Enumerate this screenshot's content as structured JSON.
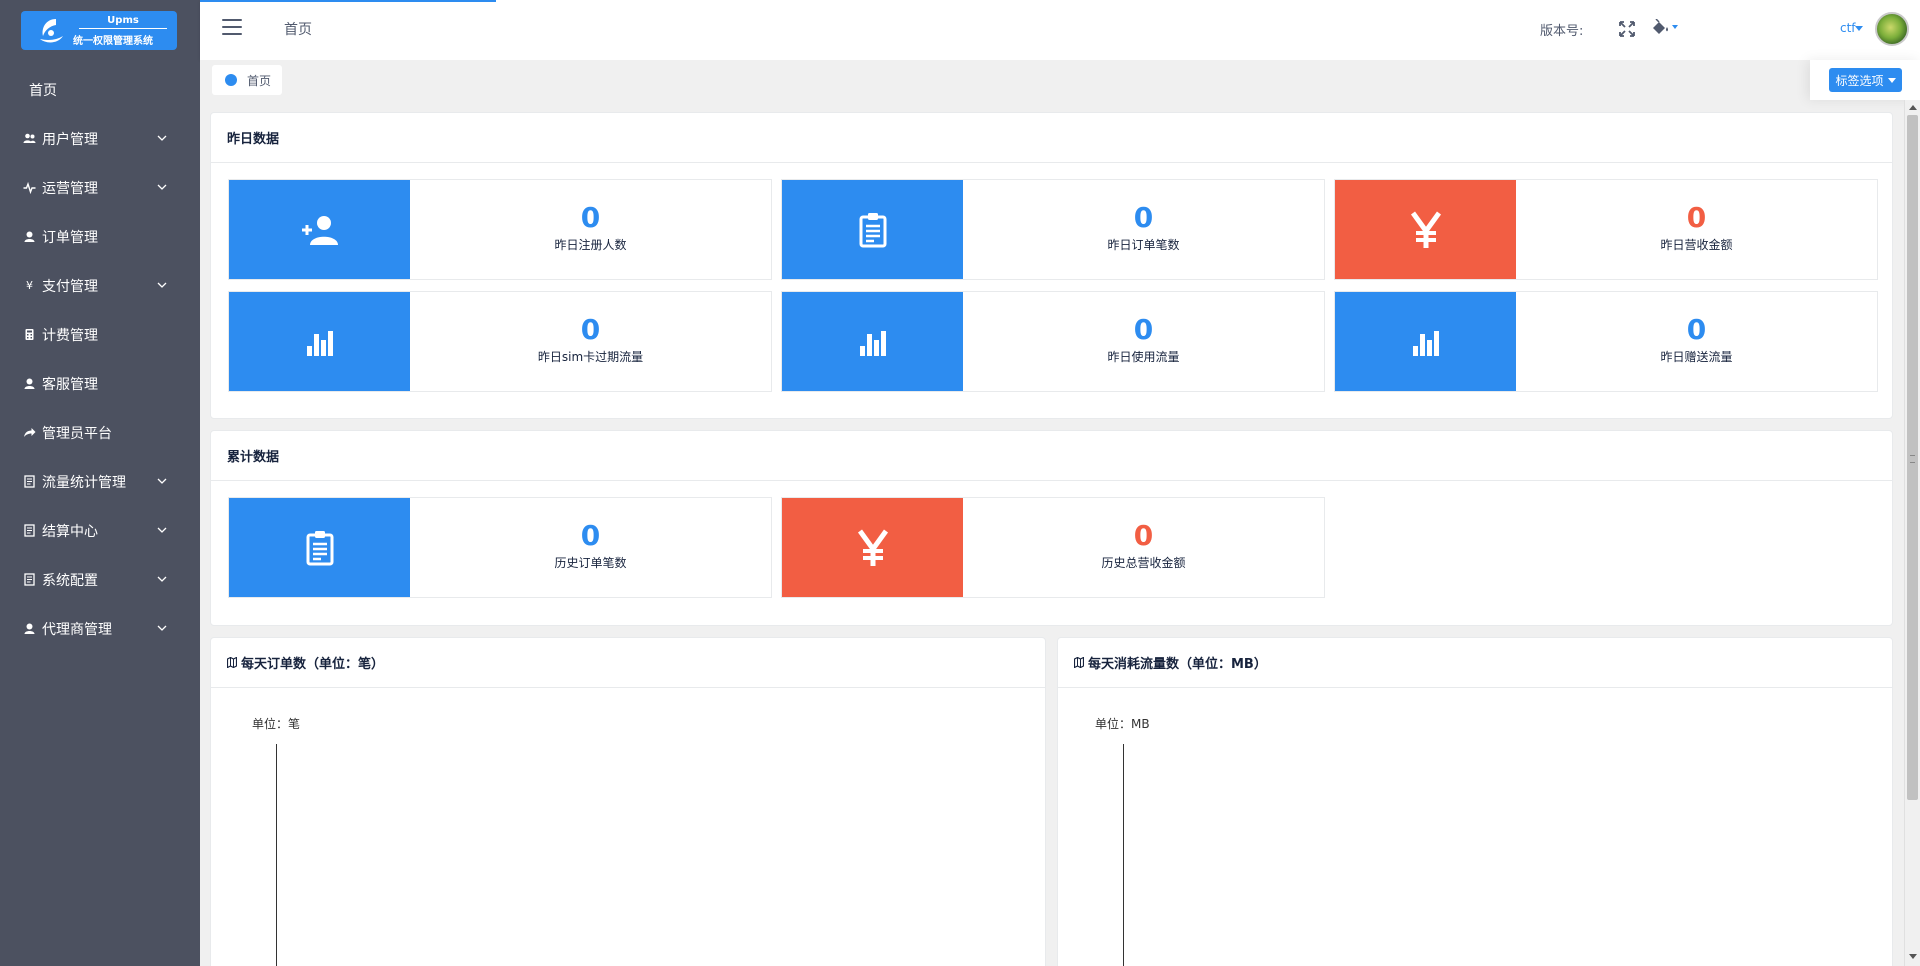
{
  "app": {
    "logo_title": "Upms",
    "logo_subtitle": "统一权限管理系统"
  },
  "sidebar": {
    "items": [
      {
        "label": "首页",
        "icon": "none",
        "expandable": false
      },
      {
        "label": "用户管理",
        "icon": "users-icon",
        "expandable": true
      },
      {
        "label": "运营管理",
        "icon": "pulse-icon",
        "expandable": true
      },
      {
        "label": "订单管理",
        "icon": "person-icon",
        "expandable": false
      },
      {
        "label": "支付管理",
        "icon": "yen-icon",
        "expandable": true
      },
      {
        "label": "计费管理",
        "icon": "calculator-icon",
        "expandable": false
      },
      {
        "label": "客服管理",
        "icon": "person-icon",
        "expandable": false
      },
      {
        "label": "管理员平台",
        "icon": "share-icon",
        "expandable": false
      },
      {
        "label": "流量统计管理",
        "icon": "document-icon",
        "expandable": true
      },
      {
        "label": "结算中心",
        "icon": "document-icon",
        "expandable": true
      },
      {
        "label": "系统配置",
        "icon": "document-icon",
        "expandable": true
      },
      {
        "label": "代理商管理",
        "icon": "person-icon",
        "expandable": true
      }
    ]
  },
  "header": {
    "breadcrumb": "首页",
    "version_label": "版本号:",
    "user_name": "ctf"
  },
  "tagbar": {
    "home_tag": "首页",
    "options_label": "标签选项"
  },
  "yesterday": {
    "title": "昨日数据",
    "stats": [
      {
        "value": "0",
        "label": "昨日注册人数",
        "icon": "add-user-icon",
        "color": "blue"
      },
      {
        "value": "0",
        "label": "昨日订单笔数",
        "icon": "clipboard-icon",
        "color": "blue"
      },
      {
        "value": "0",
        "label": "昨日营收金额",
        "icon": "yen-icon",
        "color": "red"
      },
      {
        "value": "0",
        "label": "昨日sim卡过期流量",
        "icon": "bar-chart-icon",
        "color": "blue"
      },
      {
        "value": "0",
        "label": "昨日使用流量",
        "icon": "bar-chart-icon",
        "color": "blue"
      },
      {
        "value": "0",
        "label": "昨日赠送流量",
        "icon": "bar-chart-icon",
        "color": "blue"
      }
    ]
  },
  "cumulative": {
    "title": "累计数据",
    "stats": [
      {
        "value": "0",
        "label": "历史订单笔数",
        "icon": "clipboard-icon",
        "color": "blue"
      },
      {
        "value": "0",
        "label": "历史总营收金额",
        "icon": "yen-icon",
        "color": "red"
      }
    ]
  },
  "charts": {
    "orders": {
      "title": "每天订单数（单位：笔）",
      "unit": "单位：笔"
    },
    "traffic": {
      "title": "每天消耗流量数（单位：MB）",
      "unit": "单位：MB"
    }
  },
  "colors": {
    "primary": "#2d8cf0",
    "danger": "#f25e43",
    "sidebar_bg": "#4c5160"
  }
}
